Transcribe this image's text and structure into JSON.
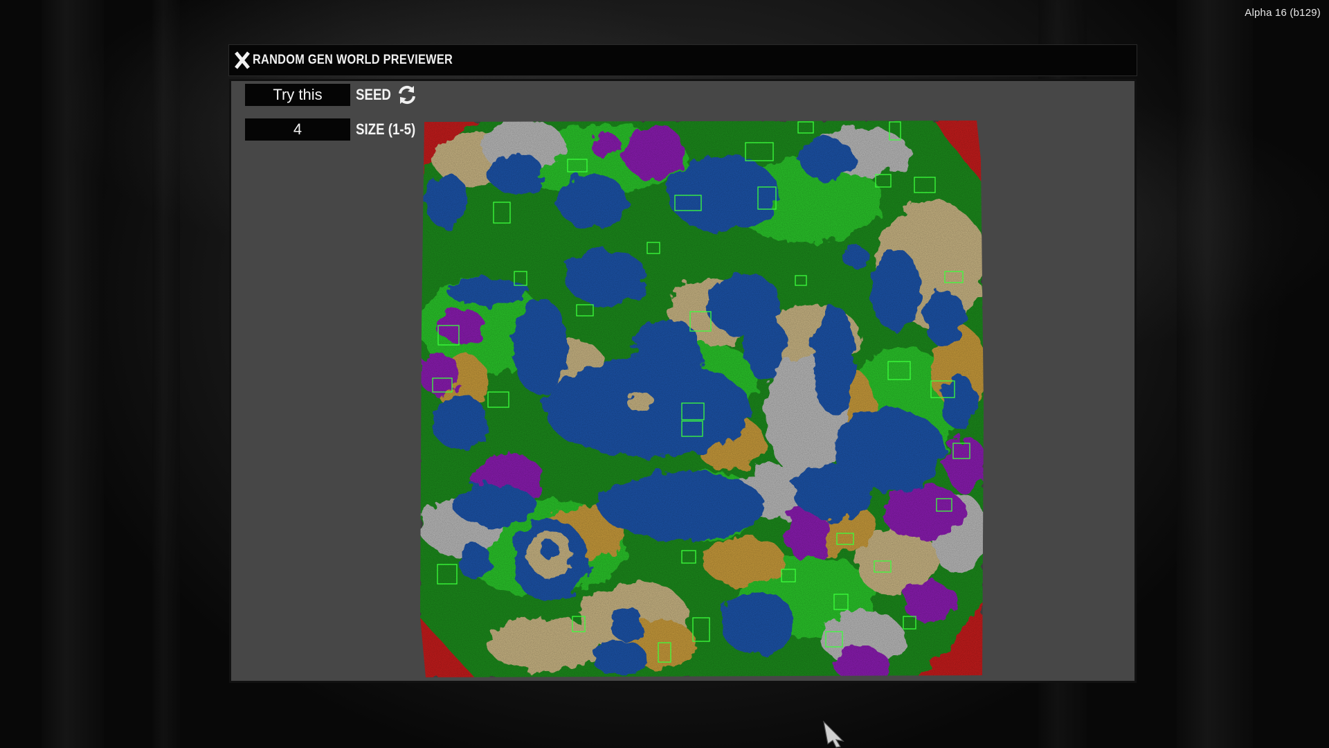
{
  "version_label": "Alpha 16 (b129)",
  "window": {
    "title": "RANDOM GEN WORLD PREVIEWER",
    "close_icon": "close-x-icon"
  },
  "seed": {
    "value": "Try this",
    "label": "SEED",
    "refresh_icon": "refresh-icon"
  },
  "size": {
    "value": "4",
    "label": "SIZE (1-5)"
  },
  "map": {
    "name": "world-preview-map",
    "biome_colors": {
      "water": "#1e52a8",
      "forest": "#1f8a1f",
      "grass": "#2cc42c",
      "desert": "#c79a3a",
      "plains": "#c8b483",
      "snow": "#b9b9b9",
      "wasteland": "#8a1fb0",
      "border": "#c41d1d",
      "poi_marker": "#3cff3c"
    }
  }
}
